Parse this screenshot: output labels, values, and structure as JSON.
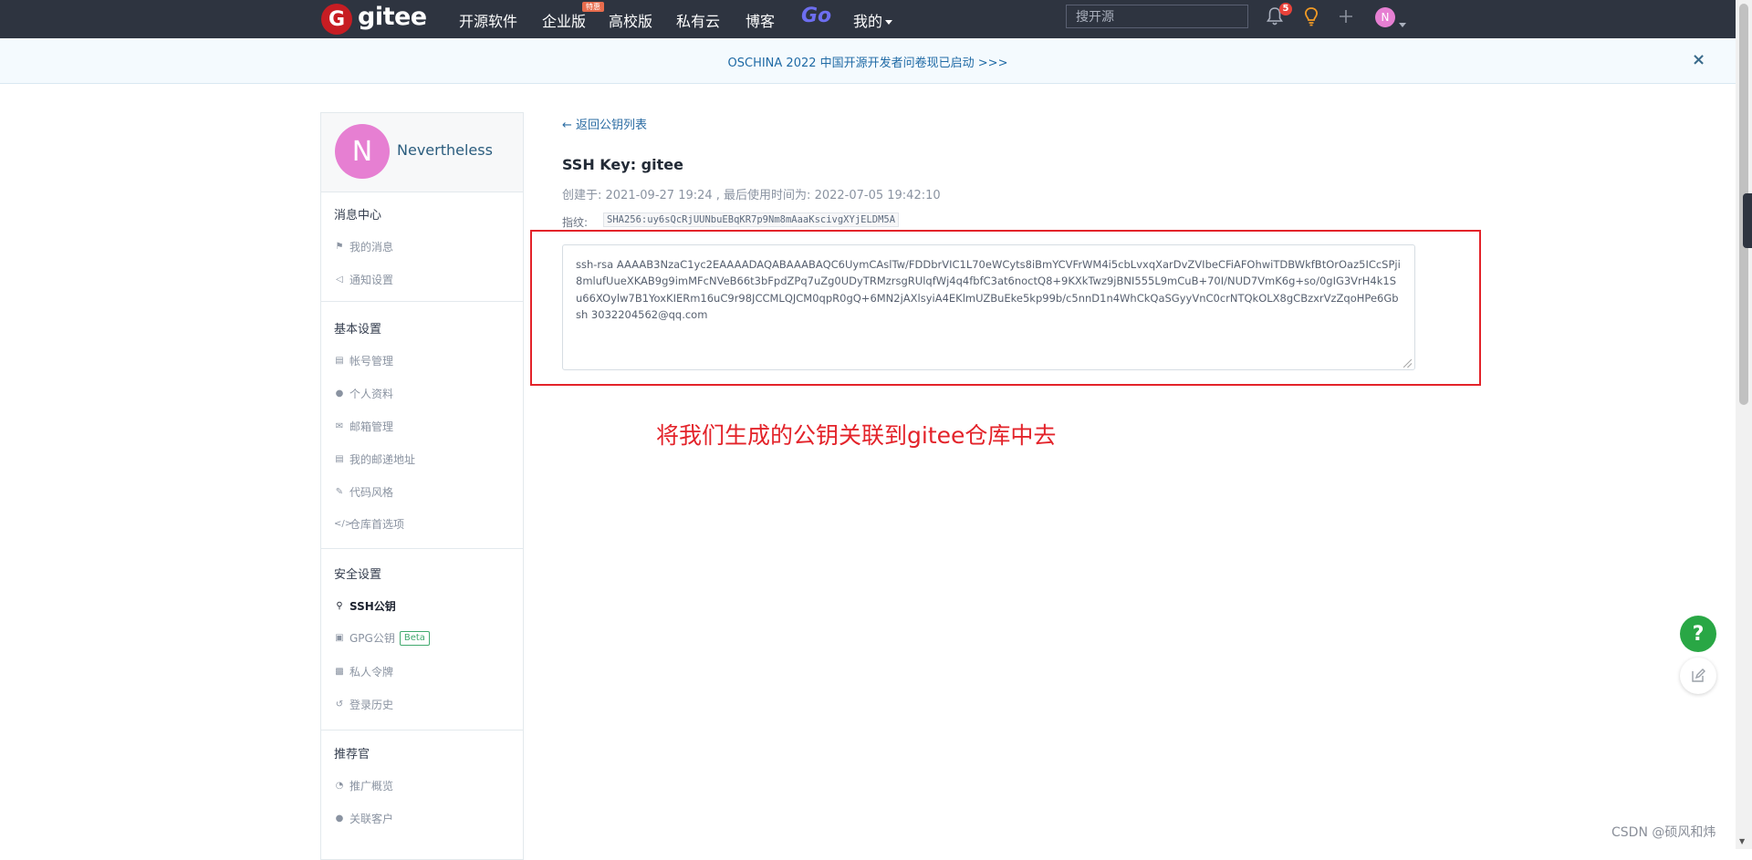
{
  "nav": {
    "logo_letter": "G",
    "logo_text": "gitee",
    "links": [
      "开源软件",
      "企业版",
      "高校版",
      "私有云",
      "博客"
    ],
    "enterprise_badge": "特惠",
    "go_label": "Go",
    "mine_label": "我的",
    "search_placeholder": "搜开源",
    "notification_count": "5",
    "avatar_letter": "N"
  },
  "banner": {
    "text": "OSCHINA 2022 中国开源开发者问卷现已启动 >>>",
    "close": "×"
  },
  "sidebar": {
    "avatar_letter": "N",
    "username": "Nevertheless",
    "sections": {
      "messages": {
        "title": "消息中心",
        "items": [
          {
            "label": "我的消息",
            "icon": "bell-icon"
          },
          {
            "label": "通知设置",
            "icon": "volume-icon"
          }
        ]
      },
      "basic": {
        "title": "基本设置",
        "items": [
          {
            "label": "帐号管理",
            "icon": "id-card-icon"
          },
          {
            "label": "个人资料",
            "icon": "user-icon"
          },
          {
            "label": "邮箱管理",
            "icon": "envelope-icon"
          },
          {
            "label": "我的邮递地址",
            "icon": "address-card-icon"
          },
          {
            "label": "代码风格",
            "icon": "brush-icon"
          },
          {
            "label": "仓库首选项",
            "icon": "code-icon"
          }
        ]
      },
      "security": {
        "title": "安全设置",
        "items": [
          {
            "label": "SSH公钥",
            "icon": "key-icon",
            "active": true
          },
          {
            "label": "GPG公钥",
            "icon": "lock-icon",
            "badge": "Beta"
          },
          {
            "label": "私人令牌",
            "icon": "token-icon"
          },
          {
            "label": "登录历史",
            "icon": "history-icon"
          }
        ]
      },
      "referral": {
        "title": "推荐官",
        "items": [
          {
            "label": "推广概览",
            "icon": "pie-chart-icon"
          },
          {
            "label": "关联客户",
            "icon": "user-link-icon"
          }
        ]
      }
    }
  },
  "main": {
    "back_link": "← 返回公钥列表",
    "title": "SSH Key: gitee",
    "meta": "创建于:   2021-09-27 19:24 , 最后使用时间为: 2022-07-05 19:42:10",
    "fingerprint_label": "指纹:",
    "fingerprint": "SHA256:uy6sQcRjUUNbuEBqKR7p9Nm8mAaaKscivgXYjELDM5A",
    "public_key": "ssh-rsa AAAAB3NzaC1yc2EAAAADAQABAAABAQC6UymCAslTw/FDDbrVIC1L70eWCyts8iBmYCVFrWM4i5cbLvxqXarDvZVIbeCFiAFOhwiTDBWkfBtOrOaz5ICcSPji8mlufUueXKAB9g9imMFcNVeB66t3bFpdZPq7uZg0UDyTRMzrsgRUlqfWj4q4fbfC3at6noctQ8+9KXkTwz9jBNI555L9mCuB+70I/NUD7VmK6g+so/0gIG3VrH4k1Su66XOylw7B1YoxKIERm16uC9r98JCCMLQJCM0qpR0gQ+6MN2jAXlsyiA4EKlmUZBuEke5kp99b/c5nnD1n4WhCkQaSGyyVnC0crNTQkOLX8gCBzxrVzZqoHPe6Gbsh 3032204562@qq.com",
    "annotation": "将我们生成的公钥关联到gitee仓库中去"
  },
  "float_buttons": {
    "help": "?"
  },
  "watermark": "CSDN @硕风和炜",
  "colors": {
    "nav_bg": "#2e3440",
    "brand_red": "#c71d23",
    "annotation_red": "#e3232a",
    "help_green": "#29a745",
    "avatar_pink": "#e67fd2"
  }
}
